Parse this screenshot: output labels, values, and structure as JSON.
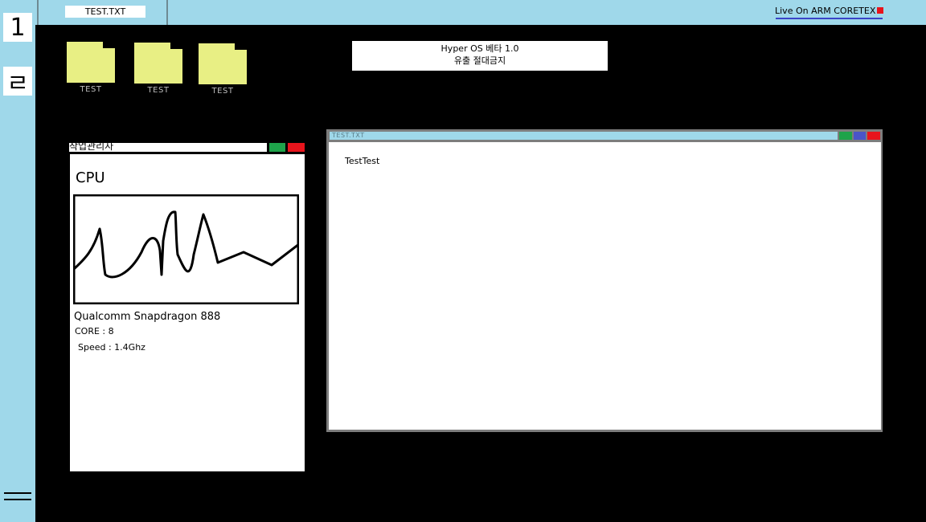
{
  "dock": {
    "buttons": [
      {
        "label": "1",
        "icon": "digit-one-icon"
      },
      {
        "label": "ㄹ",
        "icon": "korean-rieul-icon"
      }
    ],
    "menu_icon": "hamburger-menu-icon"
  },
  "topbar": {
    "tab_label": "TEST.TXT",
    "status_text": "Live On ARM CORETEX",
    "status_dot_color": "#e8141c",
    "underline_color": "#3a44c8"
  },
  "desktop": {
    "folders": [
      {
        "label": "TEST",
        "icon": "folder-icon"
      },
      {
        "label": "TEST",
        "icon": "folder-icon"
      },
      {
        "label": "TEST",
        "icon": "folder-icon"
      }
    ],
    "notice": {
      "line1": "Hyper OS 베타 1.0",
      "line2": "유출 절대금지"
    }
  },
  "task_manager": {
    "title": "작업관리자",
    "minimize_color": "#1ea34a",
    "close_color": "#e8141c",
    "heading": "CPU",
    "cpu_name": "Qualcomm Snapdragon 888",
    "cores": "CORE : 8",
    "speed": "Speed : 1.4Ghz",
    "graph_icon": "cpu-usage-graph"
  },
  "editor": {
    "title": "TEST.TXT",
    "content": "TestTest",
    "minimize_color": "#1ea34a",
    "maximize_color": "#4a54c8",
    "close_color": "#e8141c"
  },
  "colors": {
    "accent": "#9fd8ea",
    "folder": "#e8ef84",
    "desktop": "#000000"
  }
}
